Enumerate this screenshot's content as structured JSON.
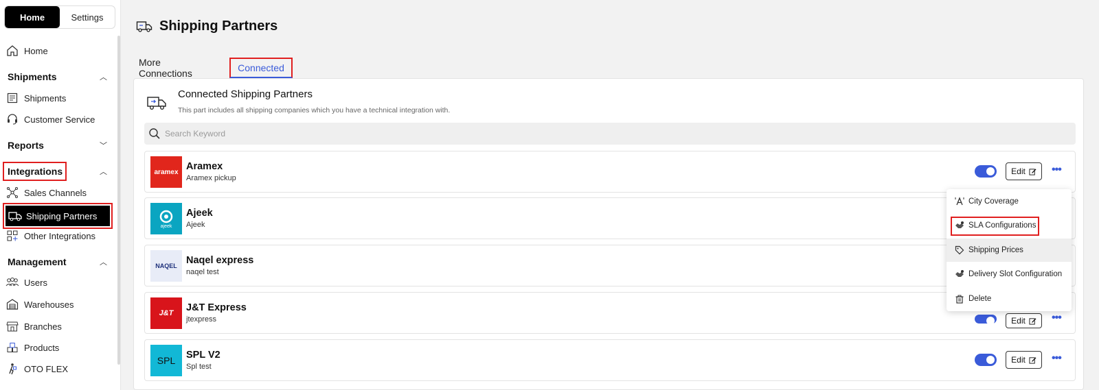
{
  "sidebar": {
    "toggle": {
      "home": "Home",
      "settings": "Settings"
    },
    "home_item": "Home",
    "sections": {
      "shipments": "Shipments",
      "reports": "Reports",
      "integrations": "Integrations",
      "management": "Management"
    },
    "items": {
      "shipments": "Shipments",
      "customer_service": "Customer Service",
      "sales_channels": "Sales Channels",
      "shipping_partners": "Shipping Partners",
      "other_integrations": "Other Integrations",
      "users": "Users",
      "warehouses": "Warehouses",
      "branches": "Branches",
      "products": "Products",
      "oto_flex": "OTO FLEX"
    }
  },
  "page": {
    "title": "Shipping Partners",
    "tabs": [
      "More Connections",
      "Connected"
    ],
    "card_title": "Connected Shipping Partners",
    "card_subtitle": "This part includes all shipping companies which you have a technical integration with.",
    "search_placeholder": "Search Keyword",
    "edit_label": "Edit"
  },
  "partners": [
    {
      "name": "Aramex",
      "desc": "Aramex pickup",
      "logo_text": "aramex",
      "logo_bg": "#e1261c",
      "enabled": true
    },
    {
      "name": "Ajeek",
      "desc": "Ajeek",
      "logo_text": "ajeek",
      "logo_bg": "#0aa5c1",
      "enabled": true
    },
    {
      "name": "Naqel express",
      "desc": "naqel test",
      "logo_text": "NAQEL",
      "logo_bg": "#e8ecf7",
      "enabled": true
    },
    {
      "name": "J&T Express",
      "desc": "jtexpress",
      "logo_text": "J&T",
      "logo_bg": "#d8141b",
      "enabled": true
    },
    {
      "name": "SPL V2",
      "desc": "Spl test",
      "logo_text": "SPL",
      "logo_bg": "#12b8d6",
      "enabled": true
    }
  ],
  "menu": {
    "items": [
      "City Coverage",
      "SLA Configurations",
      "Shipping Prices",
      "Delivery Slot Configuration",
      "Delete"
    ]
  },
  "colors": {
    "accent": "#3a5bd9",
    "highlight": "#e01e1e"
  }
}
